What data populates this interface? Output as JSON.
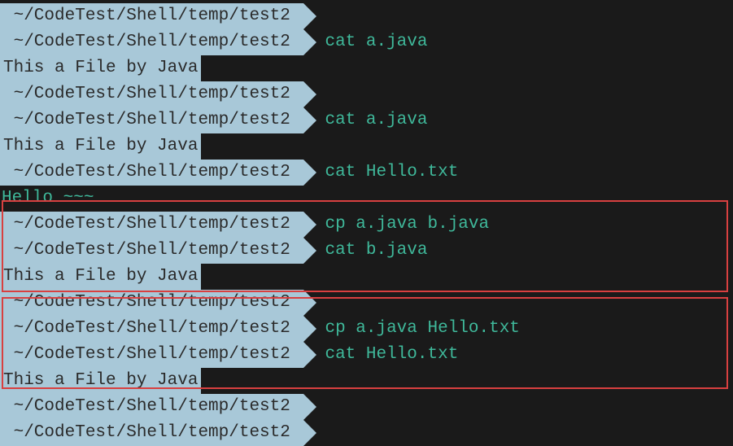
{
  "prompt_path": " ~/CodeTest/Shell/temp/test2 ",
  "lines": [
    {
      "type": "prompt",
      "command": ""
    },
    {
      "type": "prompt",
      "command": "cat a.java"
    },
    {
      "type": "output_inverted",
      "text": "This a File by Java"
    },
    {
      "type": "prompt",
      "command": ""
    },
    {
      "type": "prompt",
      "command": "cat a.java"
    },
    {
      "type": "output_inverted",
      "text": "This a File by Java"
    },
    {
      "type": "prompt",
      "command": "cat Hello.txt"
    },
    {
      "type": "output_plain",
      "text": "Hello ~~~"
    },
    {
      "type": "prompt",
      "command": "cp a.java b.java"
    },
    {
      "type": "prompt",
      "command": "cat b.java"
    },
    {
      "type": "output_inverted",
      "text": "This a File by Java"
    },
    {
      "type": "prompt",
      "command": ""
    },
    {
      "type": "prompt",
      "command": "cp a.java Hello.txt"
    },
    {
      "type": "prompt",
      "command": "cat Hello.txt"
    },
    {
      "type": "output_inverted",
      "text": "This a File by Java"
    },
    {
      "type": "prompt",
      "command": ""
    },
    {
      "type": "prompt",
      "command": ""
    }
  ],
  "highlight_boxes": [
    {
      "name": "box1",
      "covers_lines": [
        8,
        9,
        10,
        11
      ]
    },
    {
      "name": "box2",
      "covers_lines": [
        12,
        13,
        14,
        15
      ]
    }
  ]
}
